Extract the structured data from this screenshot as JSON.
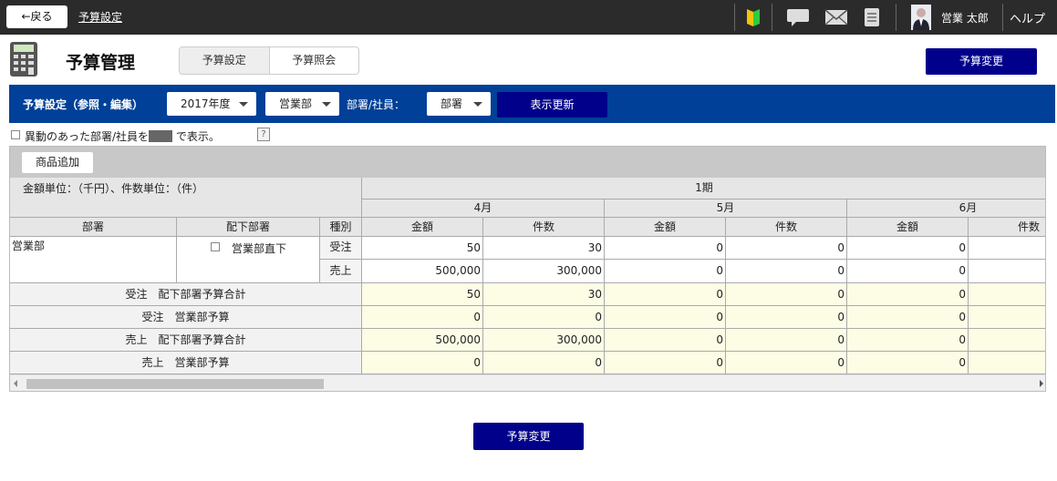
{
  "topbar": {
    "back_label": "←戻る",
    "title": "予算設定",
    "icons": [
      "beginner-leaf-icon",
      "chat-icon",
      "mail-icon",
      "memo-icon",
      "user-avatar-icon"
    ],
    "user_name": "営業 太郎",
    "help_label": "ヘルプ"
  },
  "header": {
    "title": "予算管理",
    "tabs": [
      {
        "label": "予算設定",
        "active": true
      },
      {
        "label": "予算照会",
        "active": false
      }
    ],
    "change_button": "予算変更"
  },
  "filter": {
    "section_label": "予算設定（参照・編集）",
    "year": "2017年度",
    "department": "営業部",
    "dept_employee_label": "部署/社員：",
    "mode": "部署",
    "refresh_button": "表示更新"
  },
  "diff_option": {
    "text_before": "異動のあった部署/社員を",
    "text_after": "で表示。",
    "help_mark": "?"
  },
  "table": {
    "add_product_button": "商品追加",
    "unit_note": "金額単位：（千円）、件数単位：（件）",
    "period": "1期",
    "months": [
      "4月",
      "5月",
      "6月"
    ],
    "col_amount": "金額",
    "col_count": "件数",
    "hdr_dept": "部署",
    "hdr_sub_dept": "配下部署",
    "hdr_kind": "種別",
    "dept_name": "営業部",
    "sub_dept_check_label": "営業部直下",
    "rows": [
      {
        "kind": "受注",
        "values": [
          "50",
          "30",
          "0",
          "0",
          "0"
        ]
      },
      {
        "kind": "売上",
        "values": [
          "500,000",
          "300,000",
          "0",
          "0",
          "0"
        ]
      }
    ],
    "summary_rows": [
      {
        "label": "受注　配下部署予算合計",
        "values": [
          "50",
          "30",
          "0",
          "0",
          "0"
        ]
      },
      {
        "label": "受注　営業部予算",
        "values": [
          "0",
          "0",
          "0",
          "0",
          "0"
        ]
      },
      {
        "label": "売上　配下部署予算合計",
        "values": [
          "500,000",
          "300,000",
          "0",
          "0",
          "0"
        ]
      },
      {
        "label": "売上　営業部予算",
        "values": [
          "0",
          "0",
          "0",
          "0",
          "0"
        ]
      }
    ]
  },
  "footer": {
    "change_button": "予算変更"
  },
  "colors": {
    "topbar": "#2b2b2b",
    "filterbar": "#004098",
    "primary": "#00008b",
    "yellow": "#fdfde6"
  }
}
